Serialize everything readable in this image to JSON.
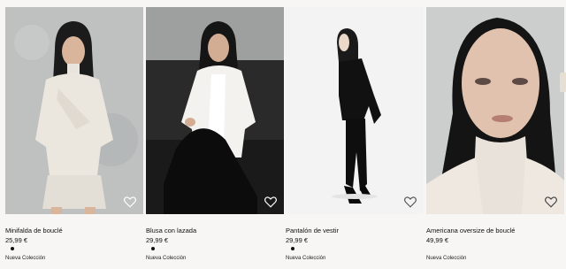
{
  "products": [
    {
      "name": "Minifalda de bouclé",
      "price": "25,99 €",
      "badge": "Nueva Colección",
      "swatch": "#111111",
      "favorite_icon": "heart-outline-icon"
    },
    {
      "name": "Blusa con lazada",
      "price": "29,99 €",
      "badge": "Nueva Colección",
      "swatch": "#111111",
      "favorite_icon": "heart-outline-icon"
    },
    {
      "name": "Pantalón de vestir",
      "price": "29,99 €",
      "badge": "Nueva Colección",
      "swatch": "#111111",
      "favorite_icon": "heart-outline-icon"
    },
    {
      "name": "Americana oversize de bouclé",
      "price": "49,99 €",
      "badge": "Nueva Colección",
      "favorite_icon": "heart-outline-icon"
    }
  ],
  "colors": {
    "background": "#f7f6f4",
    "text": "#111111"
  }
}
